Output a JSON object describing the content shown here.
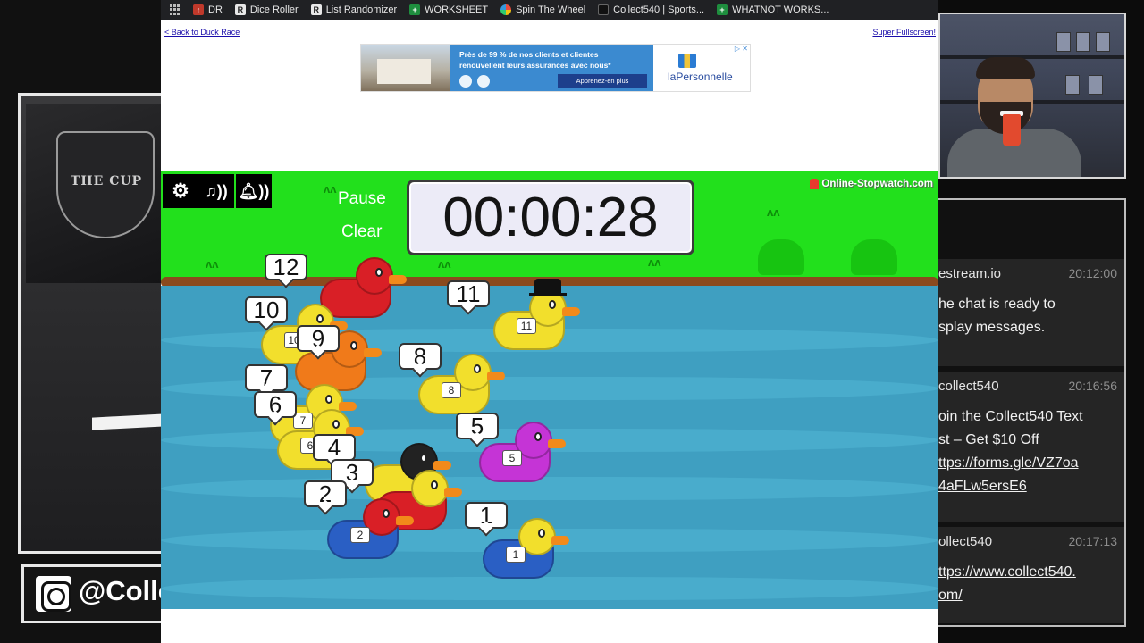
{
  "bookmarks": [
    {
      "label": "DR",
      "icon": "dr-favicon-icon",
      "color": "#c0392b"
    },
    {
      "label": "Dice Roller",
      "icon": "r-favicon-icon",
      "color": "#3a3a3a"
    },
    {
      "label": "List Randomizer",
      "icon": "r-favicon-icon",
      "color": "#3a3a3a"
    },
    {
      "label": "WORKSHEET",
      "icon": "sheets-icon",
      "color": "#1e8e3e"
    },
    {
      "label": "Spin The Wheel",
      "icon": "wheel-icon",
      "color": "#7a5bd6"
    },
    {
      "label": "Collect540 | Sports...",
      "icon": "collect540-icon",
      "color": "#222222"
    },
    {
      "label": "WHATNOT WORKS...",
      "icon": "sheets-icon",
      "color": "#1e8e3e"
    }
  ],
  "page": {
    "back_link": "< Back to Duck Race",
    "fullscreen_link": "Super Fullscreen!"
  },
  "ad": {
    "text": "Près de 99 % de nos clients et clientes renouvellent leurs assurances avec nous*",
    "cta": "Apprenez-en plus",
    "brand": "laPersonnelle",
    "close_mark": "▷ ✕"
  },
  "game": {
    "controls": {
      "settings_icon": "gear-icon",
      "music_icon": "music-sound-icon",
      "bell_icon": "bell-sound-icon"
    },
    "pause_label": "Pause",
    "clear_label": "Clear",
    "timer": "00:00:28",
    "logo": "Online-Stopwatch.com"
  },
  "ducks": [
    {
      "number": "12",
      "badge": "",
      "color": "#d91f26",
      "head": "#d91f26"
    },
    {
      "number": "10",
      "badge": "10",
      "color": "#f2df2c",
      "head": "#f2df2c"
    },
    {
      "number": "9",
      "badge": "",
      "color": "#f07a1a",
      "head": "#f07a1a"
    },
    {
      "number": "8",
      "badge": "8",
      "color": "#f2df2c",
      "head": "#f2df2c"
    },
    {
      "number": "11",
      "badge": "11",
      "color": "#f2df2c",
      "head": "#f2df2c"
    },
    {
      "number": "7",
      "badge": "7",
      "color": "#f2df2c",
      "head": "#f2df2c"
    },
    {
      "number": "6",
      "badge": "6",
      "color": "#f2df2c",
      "head": "#f2df2c"
    },
    {
      "number": "5",
      "badge": "5",
      "color": "#c534d6",
      "head": "#c534d6"
    },
    {
      "number": "4",
      "badge": "",
      "color": "#f2df2c",
      "head": "#222222"
    },
    {
      "number": "3",
      "badge": "",
      "color": "#d91f26",
      "head": "#f2df2c"
    },
    {
      "number": "2",
      "badge": "2",
      "color": "#2a5fc4",
      "head": "#d91f26"
    },
    {
      "number": "1",
      "badge": "1",
      "color": "#2a5fc4",
      "head": "#f2df2c"
    }
  ],
  "overlay": {
    "instagram_handle": "@Colle"
  },
  "chat": {
    "messages": [
      {
        "user": "estream.io",
        "time": "20:12:00",
        "lines": [
          "he chat is ready to",
          "splay messages."
        ]
      },
      {
        "user": "collect540",
        "time": "20:16:56",
        "lines": [
          "oin the Collect540 Text",
          "st – Get $10 Off",
          "ttps://forms.gle/VZ7oa",
          "4aFLw5ersE6"
        ]
      },
      {
        "user": "ollect540",
        "time": "20:17:13",
        "lines": [
          "ttps://www.collect540.",
          "om/"
        ]
      }
    ]
  }
}
